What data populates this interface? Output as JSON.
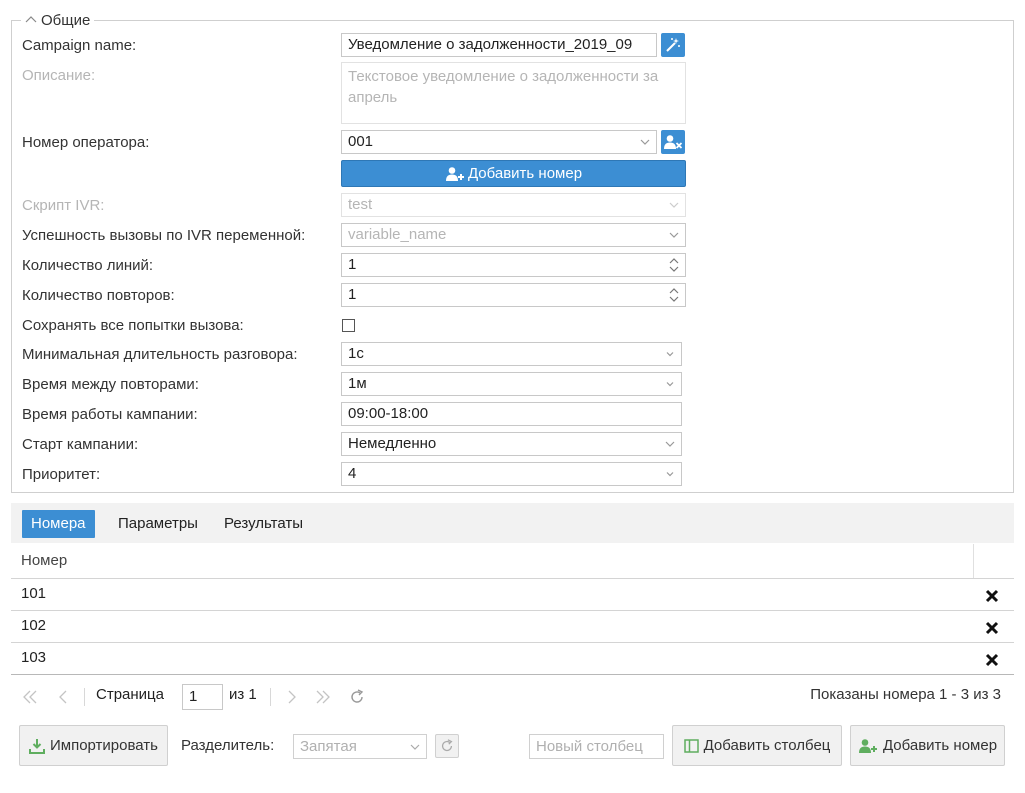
{
  "group": {
    "title": "Общие"
  },
  "form": {
    "campaign_name": {
      "label": "Campaign name:",
      "value": "Уведомление о задолженности_2019_09"
    },
    "description": {
      "label": "Описание:",
      "value": "Текстовое уведомление о задолженности за апрель"
    },
    "operator_number": {
      "label": "Номер оператора:",
      "value": "001"
    },
    "add_number_label": "Добавить номер",
    "ivr_script": {
      "label": "Скрипт IVR:",
      "value": "test"
    },
    "ivr_success": {
      "label": "Успешность вызовы по IVR переменной:",
      "value": "variable_name"
    },
    "lines": {
      "label": "Количество линий:",
      "value": "1"
    },
    "retries": {
      "label": "Количество повторов:",
      "value": "1"
    },
    "save_attempts": {
      "label": "Сохранять все попытки вызова:",
      "checked": false
    },
    "min_duration": {
      "label": "Минимальная длительность разговора:",
      "value": "1с"
    },
    "retry_interval": {
      "label": "Время между повторами:",
      "value": "1м"
    },
    "work_time": {
      "label": "Время работы кампании:",
      "value": "09:00-18:00"
    },
    "start": {
      "label": "Старт кампании:",
      "value": "Немедленно"
    },
    "priority": {
      "label": "Приоритет:",
      "value": "4"
    }
  },
  "tabs": [
    "Номера",
    "Параметры",
    "Результаты"
  ],
  "grid": {
    "column": "Номер",
    "rows": [
      "101",
      "102",
      "103"
    ]
  },
  "pager": {
    "page_label": "Страница",
    "page": "1",
    "of_label": "из 1",
    "summary": "Показаны номера 1 - 3 из 3"
  },
  "toolbar": {
    "import_label": "Импортировать",
    "separator_label": "Разделитель:",
    "separator_value": "Запятая",
    "new_column_placeholder": "Новый столбец",
    "add_column_label": "Добавить столбец",
    "add_number_label": "Добавить номер"
  },
  "colors": {
    "accent": "#3c8ed3",
    "border": "#cfcfcf",
    "disabled": "#b5b5b5"
  },
  "icons": [
    "chevron-up-icon",
    "magic-wand-icon",
    "user-remove-icon",
    "user-add-icon",
    "close-icon",
    "first-page-icon",
    "prev-page-icon",
    "next-page-icon",
    "last-page-icon",
    "refresh-icon",
    "import-icon",
    "table-column-icon"
  ]
}
